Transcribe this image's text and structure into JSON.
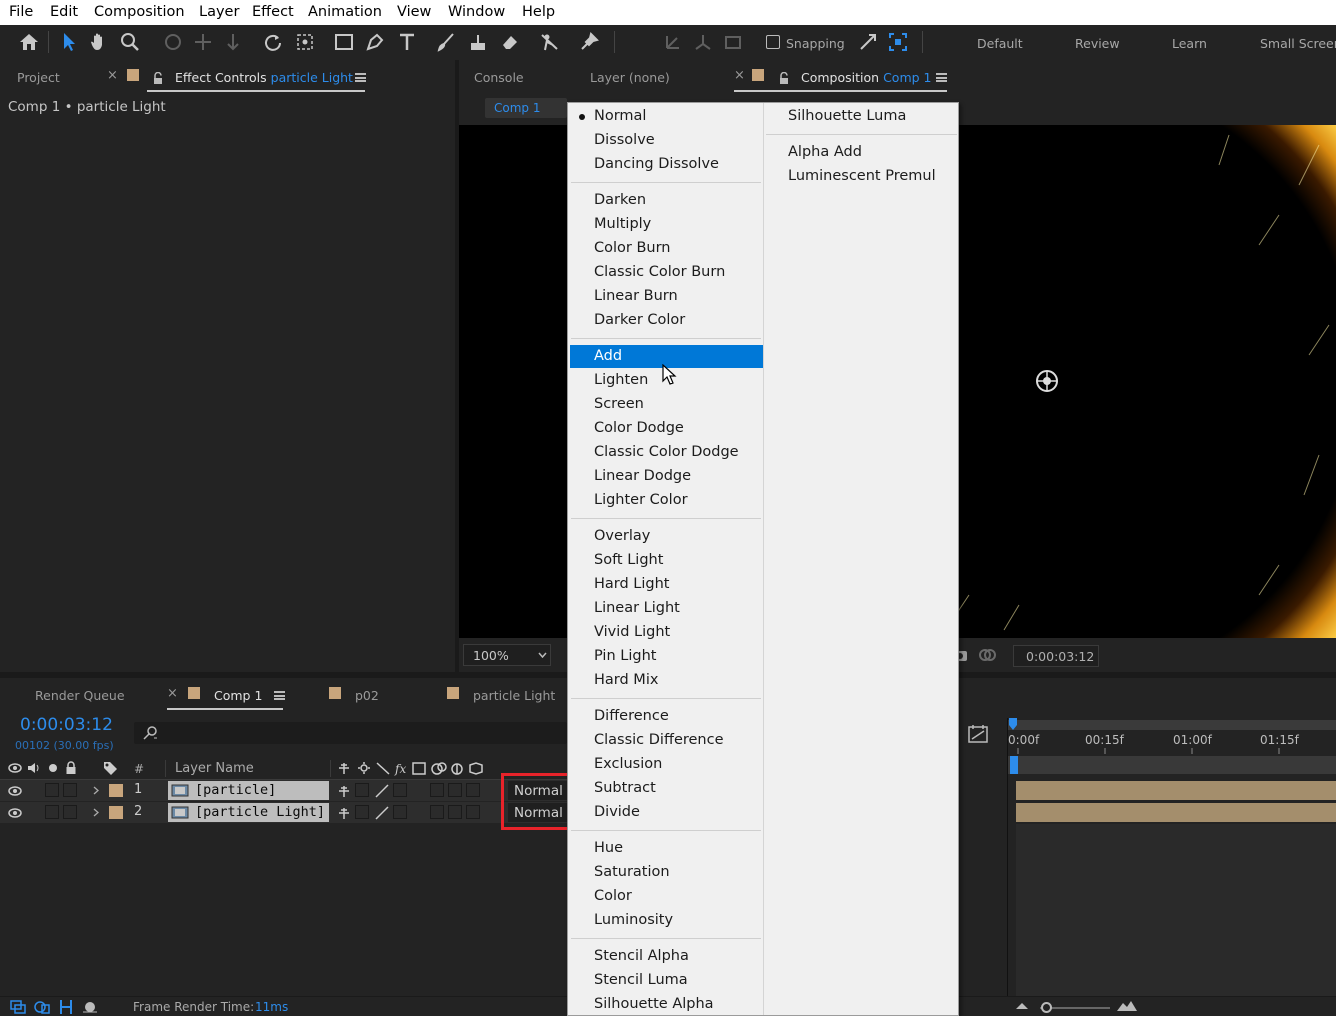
{
  "menubar": [
    "File",
    "Edit",
    "Composition",
    "Layer",
    "Effect",
    "Animation",
    "View",
    "Window",
    "Help"
  ],
  "toolbar": {
    "snapping_label": "Snapping",
    "workspaces": [
      "Default",
      "Review",
      "Learn",
      "Small Screen"
    ]
  },
  "left_panel": {
    "tab_project": "Project",
    "tab_effect_controls": "Effect Controls",
    "tab_effect_controls_target": "particle Light",
    "breadcrumb": "Comp 1 • particle Light"
  },
  "comp_panel": {
    "tab_console": "Console",
    "tab_layer": "Layer (none)",
    "tab_composition": "Composition",
    "tab_composition_target": "Comp 1",
    "flow_tab": "Comp 1",
    "zoom": "100%",
    "timecode": "0:00:03:12"
  },
  "timeline": {
    "tab_render_queue": "Render Queue",
    "tab_comp": "Comp 1",
    "tab_p02": "p02",
    "tab_particle_light": "particle Light",
    "current_time": "0:00:03:12",
    "frame_info": "00102 (30.00 fps)",
    "column_num": "#",
    "column_layer_name": "Layer Name",
    "ruler": [
      "0:00f",
      "00:15f",
      "01:00f",
      "01:15f"
    ],
    "layers": [
      {
        "num": "1",
        "name": "[particle]",
        "mode": "Normal"
      },
      {
        "num": "2",
        "name": "[particle Light]",
        "mode": "Normal"
      }
    ],
    "footer_label": "Frame Render Time:",
    "footer_value": "11ms"
  },
  "blend_menu": {
    "selected": "Normal",
    "highlighted": "Add",
    "col1_groups": [
      [
        "Normal",
        "Dissolve",
        "Dancing Dissolve"
      ],
      [
        "Darken",
        "Multiply",
        "Color Burn",
        "Classic Color Burn",
        "Linear Burn",
        "Darker Color"
      ],
      [
        "Add",
        "Lighten",
        "Screen",
        "Color Dodge",
        "Classic Color Dodge",
        "Linear Dodge",
        "Lighter Color"
      ],
      [
        "Overlay",
        "Soft Light",
        "Hard Light",
        "Linear Light",
        "Vivid Light",
        "Pin Light",
        "Hard Mix"
      ],
      [
        "Difference",
        "Classic Difference",
        "Exclusion",
        "Subtract",
        "Divide"
      ],
      [
        "Hue",
        "Saturation",
        "Color",
        "Luminosity"
      ],
      [
        "Stencil Alpha",
        "Stencil Luma",
        "Silhouette Alpha"
      ]
    ],
    "col2_groups": [
      [
        "Silhouette Luma"
      ],
      [
        "Alpha Add",
        "Luminescent Premul"
      ]
    ]
  },
  "colors": {
    "accent": "#2d8ceb",
    "menu_highlight": "#0078d7",
    "label": "#c8a57c",
    "callout": "#e8232a"
  }
}
